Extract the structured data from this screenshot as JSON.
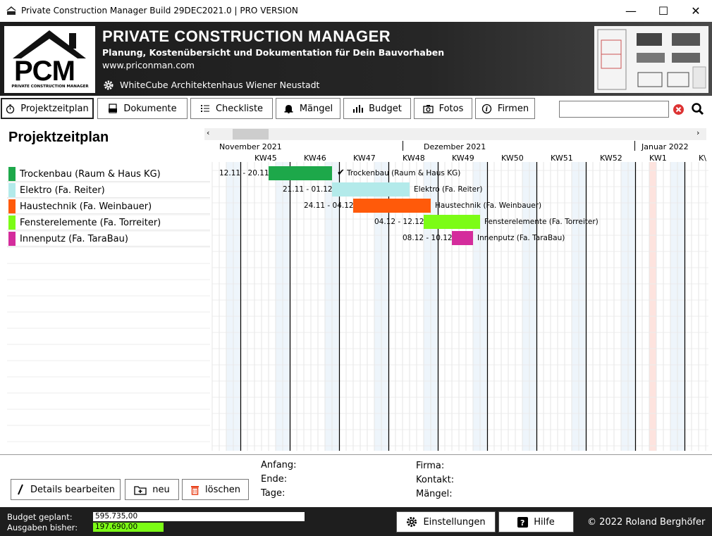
{
  "window": {
    "title": "Private Construction Manager Build 29DEC2021.0 | PRO VERSION",
    "minimize": "—",
    "maximize": "☐",
    "close": "✕"
  },
  "header": {
    "logo_text": "PCM",
    "logo_sub": "PRIVATE CONSTRUCTION MANAGER",
    "title": "PRIVATE  CONSTRUCTION  MANAGER",
    "subtitle": "Planung, Kostenübersicht und Dokumentation für Dein Bauvorhaben",
    "url": "www.priconman.com",
    "project": "WhiteCube Architektenhaus Wiener Neustadt"
  },
  "toolbar": {
    "projektzeitplan": "Projektzeitplan",
    "dokumente": "Dokumente",
    "checkliste": "Checkliste",
    "maengel": "Mängel",
    "budget": "Budget",
    "fotos": "Fotos",
    "firmen": "Firmen",
    "search_value": ""
  },
  "page_title": "Projektzeitplan",
  "timeline": {
    "months": [
      "November 2021",
      "Dezember 2021",
      "Januar 2022"
    ],
    "weeks": [
      "KW45",
      "KW46",
      "KW47",
      "KW48",
      "KW49",
      "KW50",
      "KW51",
      "KW52",
      "KW1",
      "K\\"
    ],
    "tasks": [
      {
        "name": "Trockenbau (Raum & Haus KG)",
        "range": "12.11 - 20.11",
        "label": "Trockenbau (Raum & Haus KG)",
        "done_mark": "✔",
        "color": "#1da84a"
      },
      {
        "name": "Elektro (Fa. Reiter)",
        "range": "21.11 - 01.12",
        "label": "Elektro (Fa. Reiter)",
        "color": "#b3eaea"
      },
      {
        "name": "Haustechnik (Fa. Weinbauer)",
        "range": "24.11 - 04.12",
        "label": "Haustechnik (Fa. Weinbauer)",
        "color": "#ff5a0a"
      },
      {
        "name": "Fensterelemente (Fa. Torreiter)",
        "range": "04.12 - 12.12",
        "label": "Fensterelemente (Fa. Torreiter)",
        "color": "#7cfc16"
      },
      {
        "name": "Innenputz (Fa. TaraBau)",
        "range": "08.12 - 10.12",
        "label": "Innenputz (Fa. TaraBau)",
        "color": "#d42c9c"
      }
    ]
  },
  "details": {
    "anfang": "Anfang:",
    "ende": "Ende:",
    "tage": "Tage:",
    "firma": "Firma:",
    "kontakt": "Kontakt:",
    "maengel": "Mängel:"
  },
  "actions": {
    "edit": "Details bearbeiten",
    "new": "neu",
    "delete": "löschen"
  },
  "status": {
    "budget_label": "Budget  geplant:",
    "budget_value": "595.735,00",
    "spent_label": "Ausgaben bisher:",
    "spent_value": "197.690,00",
    "spent_fraction": 0.332,
    "settings": "Einstellungen",
    "help": "Hilfe",
    "copyright": "© 2022 Roland Berghöfer"
  }
}
